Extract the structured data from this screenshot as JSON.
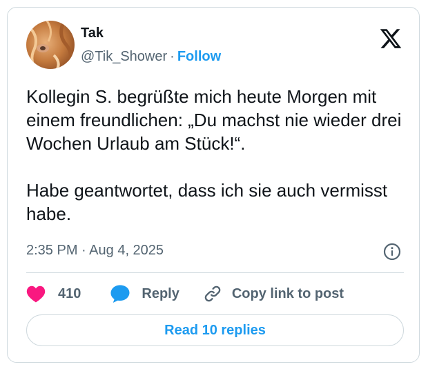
{
  "author": {
    "name": "Tak",
    "handle": "@Tik_Shower",
    "separator": "·",
    "follow_label": "Follow"
  },
  "tweet": {
    "paragraphs": [
      "Kollegin S. begrüßte mich heute Morgen mit einem freundlichen: „Du machst nie wieder drei Wochen Urlaub am Stück!“.",
      "Habe geantwortet, dass ich sie auch vermisst habe."
    ],
    "time": "2:35 PM",
    "separator": "·",
    "date": "Aug 4, 2025"
  },
  "actions": {
    "like_count": "410",
    "reply_label": "Reply",
    "copy_link_label": "Copy link to post"
  },
  "read_replies_label": "Read 10 replies",
  "icons": {
    "brand": "x-logo-icon",
    "info": "info-icon",
    "like": "heart-icon",
    "reply": "speech-bubble-icon",
    "copy": "link-icon"
  },
  "colors": {
    "accent": "#1d9bf0",
    "like": "#f91880",
    "text": "#0f1419",
    "muted": "#536471",
    "border": "#cfd9de"
  }
}
